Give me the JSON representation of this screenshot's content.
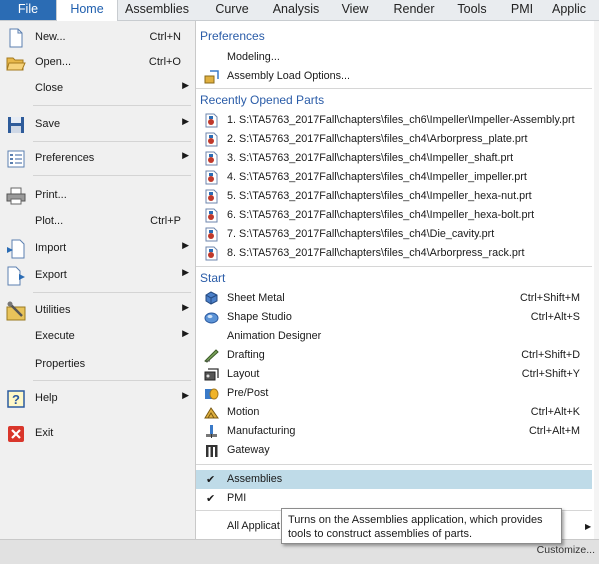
{
  "ribbon": {
    "tabs": [
      "File",
      "Home",
      "Assemblies",
      "Curve",
      "Analysis",
      "View",
      "Render",
      "Tools",
      "PMI",
      "Applic"
    ],
    "accent_color": "#2b6cb4"
  },
  "left_menu": {
    "items": [
      {
        "label": "New...",
        "shortcut": "Ctrl+N",
        "submenu": false,
        "icon": "new-file-icon"
      },
      {
        "label": "Open...",
        "shortcut": "Ctrl+O",
        "submenu": false,
        "icon": "open-folder-icon"
      },
      {
        "label": "Close",
        "shortcut": "",
        "submenu": true,
        "icon": ""
      },
      {
        "label": "Save",
        "shortcut": "",
        "submenu": true,
        "icon": "save-icon"
      },
      {
        "label": "Preferences",
        "shortcut": "",
        "submenu": true,
        "icon": "preferences-icon"
      },
      {
        "label": "Print...",
        "shortcut": "",
        "submenu": false,
        "icon": "printer-icon"
      },
      {
        "label": "Plot...",
        "shortcut": "Ctrl+P",
        "submenu": false,
        "icon": ""
      },
      {
        "label": "Import",
        "shortcut": "",
        "submenu": true,
        "icon": "import-icon"
      },
      {
        "label": "Export",
        "shortcut": "",
        "submenu": true,
        "icon": "export-icon"
      },
      {
        "label": "Utilities",
        "shortcut": "",
        "submenu": true,
        "icon": "utilities-icon"
      },
      {
        "label": "Execute",
        "shortcut": "",
        "submenu": true,
        "icon": ""
      },
      {
        "label": "Properties",
        "shortcut": "",
        "submenu": false,
        "icon": ""
      },
      {
        "label": "Help",
        "shortcut": "",
        "submenu": true,
        "icon": "help-icon"
      },
      {
        "label": "Exit",
        "shortcut": "",
        "submenu": false,
        "icon": "exit-icon"
      }
    ]
  },
  "preferences": {
    "heading": "Preferences",
    "items": [
      "Modeling...",
      "Assembly Load Options..."
    ]
  },
  "recent_parts": {
    "heading": "Recently Opened Parts",
    "items": [
      "1. S:\\TA5763_2017Fall\\chapters\\files_ch6\\Impeller\\Impeller-Assembly.prt",
      "2. S:\\TA5763_2017Fall\\chapters\\files_ch4\\Arborpress_plate.prt",
      "3. S:\\TA5763_2017Fall\\chapters\\files_ch4\\Impeller_shaft.prt",
      "4. S:\\TA5763_2017Fall\\chapters\\files_ch4\\Impeller_impeller.prt",
      "5. S:\\TA5763_2017Fall\\chapters\\files_ch4\\Impeller_hexa-nut.prt",
      "6. S:\\TA5763_2017Fall\\chapters\\files_ch4\\Impeller_hexa-bolt.prt",
      "7. S:\\TA5763_2017Fall\\chapters\\files_ch4\\Die_cavity.prt",
      "8. S:\\TA5763_2017Fall\\chapters\\files_ch4\\Arborpress_rack.prt"
    ]
  },
  "start": {
    "heading": "Start",
    "items": [
      {
        "label": "Sheet Metal",
        "shortcut": "Ctrl+Shift+M",
        "icon": "sheet-metal-icon"
      },
      {
        "label": "Shape Studio",
        "shortcut": "Ctrl+Alt+S",
        "icon": "shape-studio-icon"
      },
      {
        "label": "Animation Designer",
        "shortcut": "",
        "icon": ""
      },
      {
        "label": "Drafting",
        "shortcut": "Ctrl+Shift+D",
        "icon": "drafting-icon"
      },
      {
        "label": "Layout",
        "shortcut": "Ctrl+Shift+Y",
        "icon": "layout-icon"
      },
      {
        "label": "Pre/Post",
        "shortcut": "",
        "icon": "pre-post-icon"
      },
      {
        "label": "Motion",
        "shortcut": "Ctrl+Alt+K",
        "icon": "motion-icon"
      },
      {
        "label": "Manufacturing",
        "shortcut": "Ctrl+Alt+M",
        "icon": "manufacturing-icon"
      },
      {
        "label": "Gateway",
        "shortcut": "",
        "icon": "gateway-icon"
      }
    ]
  },
  "applications": {
    "items": [
      {
        "label": "Assemblies",
        "checked": true,
        "highlighted": true
      },
      {
        "label": "PMI",
        "checked": true,
        "highlighted": false
      },
      {
        "label": "All Applicat",
        "checked": false,
        "highlighted": false
      }
    ]
  },
  "tooltip": {
    "line1": "Turns on the Assemblies application, which provides",
    "line2": "tools to construct assemblies of parts."
  },
  "bottom_bar": {
    "customize_label": "Customize..."
  }
}
